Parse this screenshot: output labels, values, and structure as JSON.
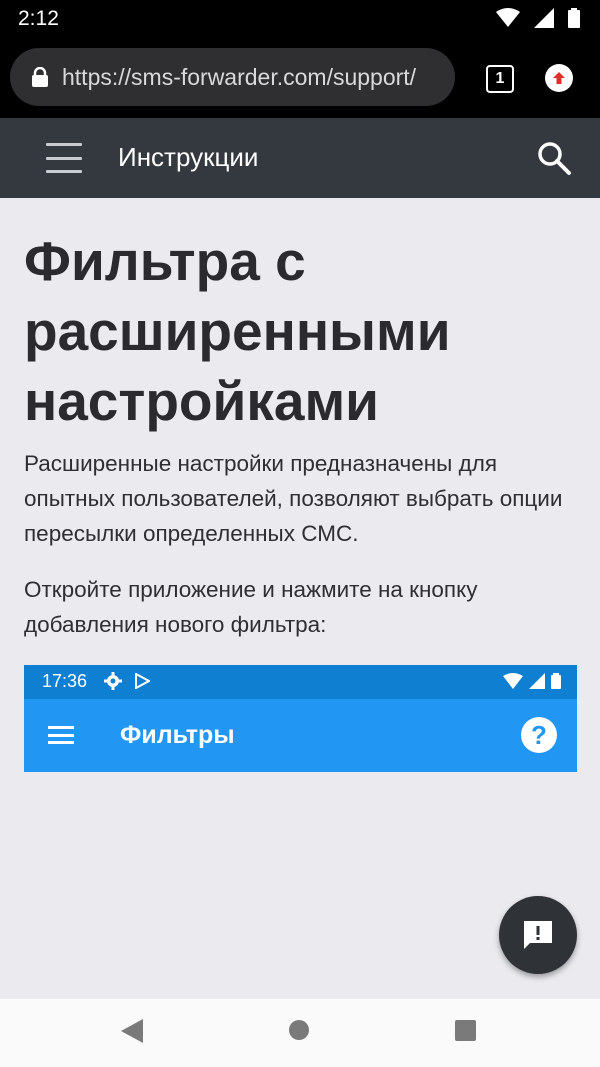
{
  "status_bar": {
    "time": "2:12",
    "icons": [
      "wifi-icon",
      "cell-signal-icon",
      "battery-icon"
    ]
  },
  "browser": {
    "url": "https://sms-forwarder.com/support/",
    "tab_count": "1",
    "icons": [
      "lock-icon",
      "tabs-icon",
      "update-icon"
    ]
  },
  "site_header": {
    "title": "Инструкции",
    "icons": [
      "menu-icon",
      "search-icon"
    ]
  },
  "article": {
    "title": "Фильтра с расширенными настройками",
    "paragraphs": [
      "Расширенные настройки предназначены для опытных пользователей, позволяют выбрать опции пересылки определенных СМС.",
      "Откройте приложение и нажмите на кнопку добавления нового фильтра:"
    ]
  },
  "embedded_screenshot": {
    "time": "17:36",
    "title": "Фильтры",
    "help_glyph": "?",
    "colors": {
      "toolbar": "#2196f3",
      "status": "#0f7fd2"
    }
  },
  "feedback_button": {
    "glyph": "!",
    "icon": "feedback-icon"
  },
  "nav_bar": {
    "icons": [
      "back-icon",
      "home-icon",
      "recents-icon"
    ]
  },
  "colors": {
    "header": "#34383f",
    "page_background": "#ebeaef",
    "text": "#2b2b2f"
  }
}
